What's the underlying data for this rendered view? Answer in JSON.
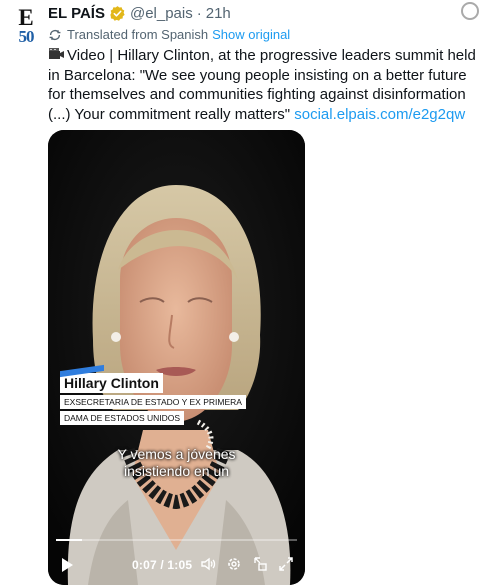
{
  "account": {
    "avatar_letter": "E",
    "avatar_number": "50",
    "name": "EL PAÍS",
    "handle": "@el_pais",
    "separator": "·",
    "time": "21h"
  },
  "translation": {
    "label": "Translated from Spanish",
    "show_original": "Show original"
  },
  "tweet": {
    "text": "Video | Hillary Clinton, at the progressive leaders summit held in Barcelona: \"We see young people insisting on a better future for themselves and communities fighting against disinformation (...) Your commitment really matters\"",
    "link": "social.elpais.com/e2g2qw"
  },
  "video": {
    "lower_third_name": "Hillary Clinton",
    "lower_third_title_1": "EXSECRETARIA DE ESTADO Y EX PRIMERA",
    "lower_third_title_2": "DAMA DE ESTADOS UNIDOS",
    "caption_1": "Y vemos a jóvenes",
    "caption_2": "insistiendo en un",
    "time": "0:07 / 1:05",
    "progress_fraction": 0.108
  },
  "colors": {
    "link": "#1d9bf0",
    "secondary_text": "#536471",
    "verified_badge": "#e2b719"
  },
  "icons": [
    "verified-badge-icon",
    "translate-icon",
    "camera-icon",
    "play-icon",
    "volume-icon",
    "settings-icon",
    "pip-icon",
    "fullscreen-icon",
    "more-icon"
  ]
}
